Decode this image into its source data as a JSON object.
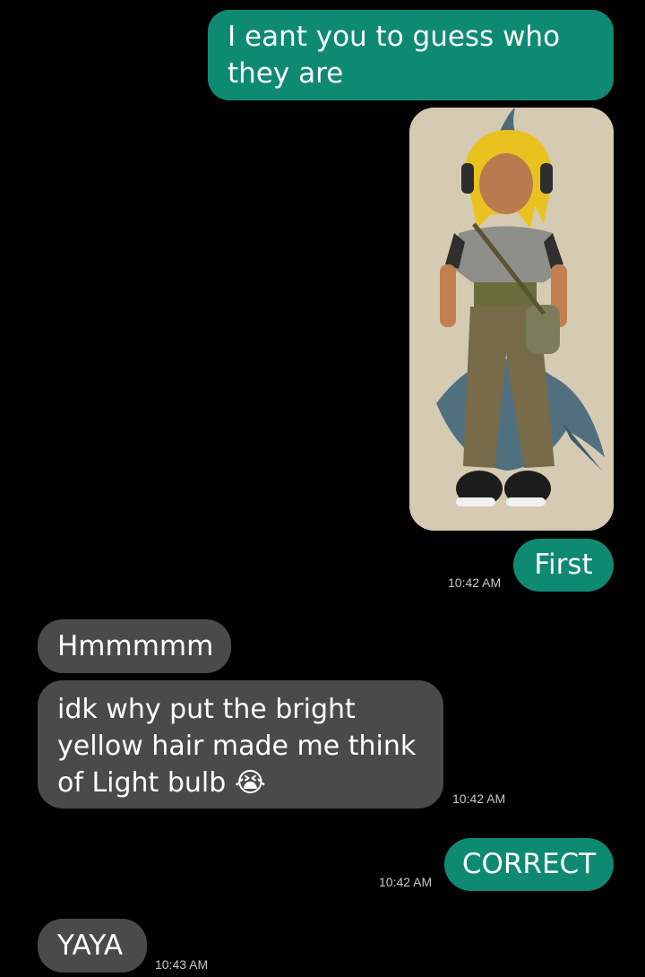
{
  "messages": [
    {
      "text": "I eant you to guess who they are"
    },
    {
      "text": "First",
      "time": "10:42 AM"
    },
    {
      "text": "Hmmmmm"
    },
    {
      "text": "idk why put the bright yellow hair made me think of Light bulb",
      "emoji": "😭",
      "time": "10:42 AM"
    },
    {
      "text": "CORRECT",
      "time": "10:42 AM"
    },
    {
      "text": "YAYA",
      "time": "10:43 AM"
    }
  ],
  "colors": {
    "sent": "#0e8a73",
    "received": "#4a4a4a",
    "background": "#000000"
  }
}
